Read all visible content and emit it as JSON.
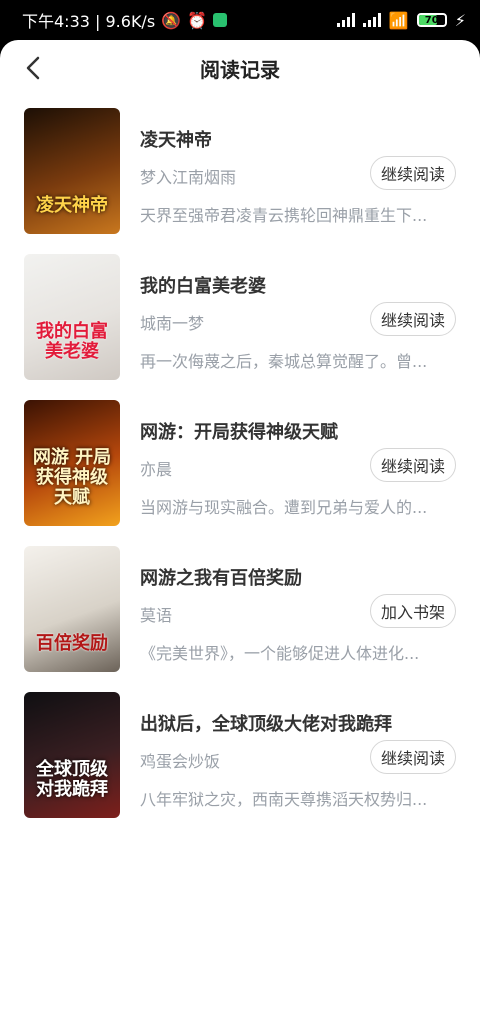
{
  "status": {
    "time_speed": "下午4:33 | 9.6K/s",
    "battery": "70"
  },
  "header": {
    "title": "阅读记录"
  },
  "books": [
    {
      "title": "凌天神帝",
      "author": "梦入江南烟雨",
      "desc": "天界至强帝君凌青云携轮回神鼎重生下...",
      "action": "继续阅读",
      "cover_text": "凌天神帝",
      "colors": [
        "#1c0f05",
        "#7a3b0e",
        "#c8771e"
      ]
    },
    {
      "title": "我的白富美老婆",
      "author": "城南一梦",
      "desc": "再一次侮蔑之后，秦城总算觉醒了。曾...",
      "action": "继续阅读",
      "cover_text": "我的白富美老婆",
      "colors": [
        "#f2f2f0",
        "#e6e3df",
        "#cfc9c3"
      ]
    },
    {
      "title": "网游：开局获得神级天赋",
      "author": "亦晨",
      "desc": "当网游与现实融合。遭到兄弟与爱人的...",
      "action": "继续阅读",
      "cover_text": "网游 开局获得神级天赋",
      "colors": [
        "#3a1203",
        "#b5470c",
        "#f2a21d"
      ]
    },
    {
      "title": "网游之我有百倍奖励",
      "author": "莫语",
      "desc": "《完美世界》，一个能够促进人体进化...",
      "action": "加入书架",
      "cover_text": "百倍奖励",
      "colors": [
        "#f4f1ec",
        "#d8d2c8",
        "#6b6258"
      ]
    },
    {
      "title": "出狱后，全球顶级大佬对我跪拜",
      "author": "鸡蛋会炒饭",
      "desc": "八年牢狱之灾，西南天尊携滔天权势归...",
      "action": "继续阅读",
      "cover_text": "全球顶级 对我跪拜",
      "colors": [
        "#0f0f12",
        "#3a1f22",
        "#7d1f1b"
      ]
    }
  ]
}
